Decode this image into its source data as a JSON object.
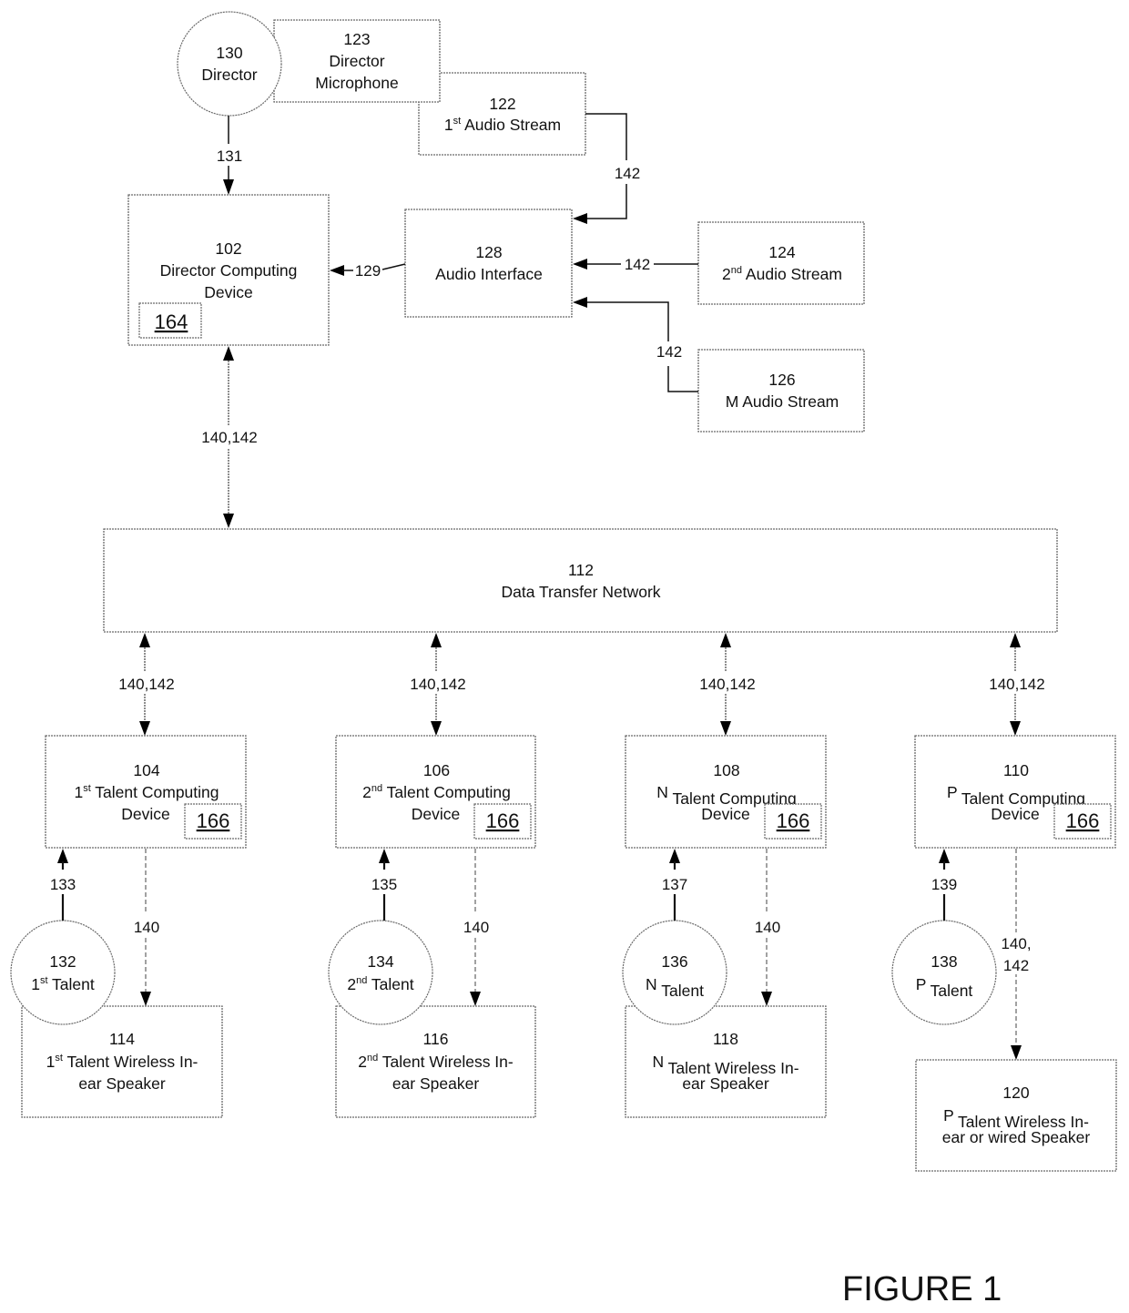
{
  "figure_label": "FIGURE 1",
  "nodes": {
    "director": {
      "id": "130",
      "line1": "Director"
    },
    "director_mic": {
      "id": "123",
      "line1": "Director",
      "line2": "Microphone"
    },
    "audio_stream_1": {
      "id": "122",
      "ord": "1",
      "sup": "st",
      "rest": " Audio Stream"
    },
    "director_device": {
      "id": "102",
      "line1": "Director Computing",
      "line2": "Device",
      "sub": "164"
    },
    "audio_interface": {
      "id": "128",
      "line1": "Audio Interface"
    },
    "audio_stream_2": {
      "id": "124",
      "ord": "2",
      "sup": "nd",
      "rest": " Audio Stream"
    },
    "audio_stream_m": {
      "id": "126",
      "line1": "M Audio Stream"
    },
    "network": {
      "id": "112",
      "line1": "Data Transfer Network"
    },
    "talent_devices": [
      {
        "id": "104",
        "ord": "1",
        "sup": "st",
        "rest": " Talent Computing",
        "line2": "Device",
        "sub": "166"
      },
      {
        "id": "106",
        "ord": "2",
        "sup": "nd",
        "rest": " Talent Computing",
        "line2": "Device",
        "sub": "166"
      },
      {
        "id": "108",
        "ord": "N",
        "sup": "",
        "rest": " Talent Computing",
        "line2": "Device",
        "sub": "166"
      },
      {
        "id": "110",
        "ord": "P",
        "sup": "",
        "rest": " Talent Computing",
        "line2": "Device",
        "sub": "166"
      }
    ],
    "talents": [
      {
        "id": "132",
        "ord": "1",
        "sup": "st",
        "rest": " Talent"
      },
      {
        "id": "134",
        "ord": "2",
        "sup": "nd",
        "rest": " Talent"
      },
      {
        "id": "136",
        "ord": "N",
        "sup": "",
        "rest": " Talent"
      },
      {
        "id": "138",
        "ord": "P",
        "sup": "",
        "rest": " Talent"
      }
    ],
    "speakers": [
      {
        "id": "114",
        "ord": "1",
        "sup": "st",
        "rest": " Talent Wireless In-",
        "line2": "ear Speaker"
      },
      {
        "id": "116",
        "ord": "2",
        "sup": "nd",
        "rest": " Talent Wireless In-",
        "line2": "ear Speaker"
      },
      {
        "id": "118",
        "ord": "N",
        "sup": "",
        "rest": " Talent Wireless In-",
        "line2": "ear Speaker"
      },
      {
        "id": "120",
        "ord": "P",
        "sup": "",
        "rest": " Talent Wireless In-",
        "line2": "ear or wired Speaker"
      }
    ]
  },
  "edges": {
    "director_to_device": "131",
    "interface_to_device": "129",
    "stream1_to_interface": "142",
    "stream2_to_interface": "142",
    "streamm_to_interface": "142",
    "device_network": "140,142",
    "network_talent": [
      "140,142",
      "140,142",
      "140,142",
      "140,142"
    ],
    "talent_to_device": [
      "133",
      "135",
      "137",
      "139"
    ],
    "device_to_speaker": [
      "140",
      "140",
      "140"
    ],
    "device_to_speaker_p_line1": "140,",
    "device_to_speaker_p_line2": "142"
  }
}
